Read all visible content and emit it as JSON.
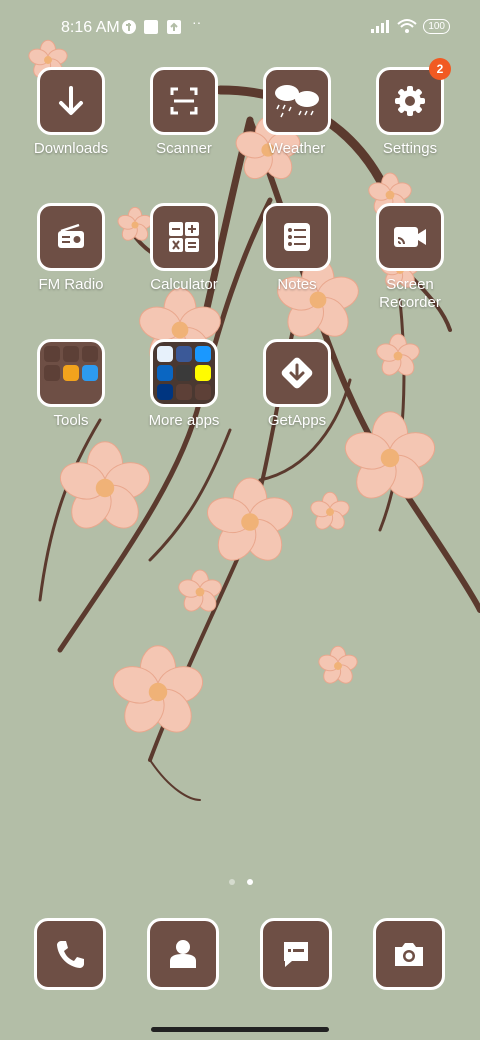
{
  "status_bar": {
    "time": "8:16 AM",
    "battery": "100"
  },
  "apps": [
    {
      "label": "Downloads",
      "icon": "download-icon"
    },
    {
      "label": "Scanner",
      "icon": "scanner-icon"
    },
    {
      "label": "Weather",
      "icon": "weather-icon"
    },
    {
      "label": "Settings",
      "icon": "gear-icon",
      "badge": "2"
    },
    {
      "label": "FM Radio",
      "icon": "radio-icon"
    },
    {
      "label": "Calculator",
      "icon": "calculator-icon"
    },
    {
      "label": "Notes",
      "icon": "notes-list-icon"
    },
    {
      "label": "Screen Recorder",
      "icon": "video-camera-icon"
    },
    {
      "label": "Tools",
      "icon": "folder-icon"
    },
    {
      "label": "More apps",
      "icon": "folder-icon"
    },
    {
      "label": "GetApps",
      "icon": "getapps-icon"
    }
  ],
  "dock": [
    {
      "icon": "phone-icon"
    },
    {
      "icon": "contacts-icon"
    },
    {
      "icon": "messages-icon"
    },
    {
      "icon": "camera-icon"
    }
  ],
  "page_indicator": {
    "pages": 2,
    "current": 2
  },
  "colors": {
    "tile": "#6e4f45",
    "background": "#b3bea7",
    "badge": "#f15a22"
  }
}
